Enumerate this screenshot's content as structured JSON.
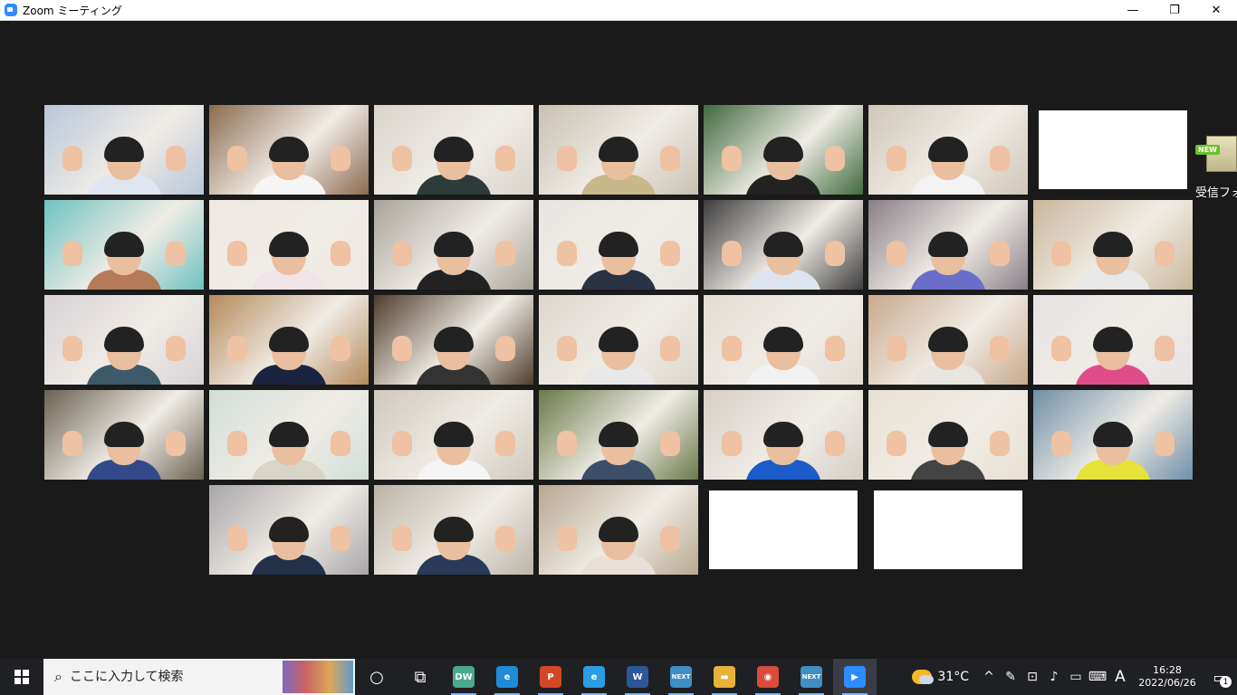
{
  "window": {
    "title": "Zoom ミーティング",
    "minimize": "—",
    "maximize": "❐",
    "close": "✕"
  },
  "gallery": {
    "active_speaker_color": "#e3e77a",
    "rows": [
      [
        "participant",
        "participant-active",
        "participant",
        "participant",
        "participant",
        "participant",
        "blank"
      ],
      [
        "participant",
        "participant",
        "participant",
        "participant",
        "participant",
        "participant",
        "participant"
      ],
      [
        "participant",
        "participant",
        "participant",
        "participant",
        "participant",
        "participant",
        "participant"
      ],
      [
        "participant",
        "participant",
        "participant",
        "participant",
        "participant",
        "participant",
        "participant"
      ],
      [
        "none",
        "participant",
        "participant",
        "participant",
        "blank",
        "blank",
        "none"
      ]
    ]
  },
  "desktop_icon": {
    "badge": "NEW",
    "label": "受信フォ"
  },
  "taskbar": {
    "search_placeholder": "ここに入力して検索",
    "apps": [
      {
        "name": "cortana",
        "glyph": "○",
        "color": "transparent"
      },
      {
        "name": "task-view",
        "glyph": "⧉",
        "color": "transparent"
      },
      {
        "name": "dw",
        "glyph": "DW",
        "color": "#4aa88c"
      },
      {
        "name": "edge",
        "glyph": "e",
        "color": "#1f8ad6"
      },
      {
        "name": "powerpoint",
        "glyph": "P",
        "color": "#d24726"
      },
      {
        "name": "ie",
        "glyph": "e",
        "color": "#2b9ee3"
      },
      {
        "name": "word",
        "glyph": "W",
        "color": "#2b579a"
      },
      {
        "name": "next1",
        "glyph": "NEXT",
        "color": "#3f8fc4"
      },
      {
        "name": "explorer",
        "glyph": "▬",
        "color": "#e8b13a"
      },
      {
        "name": "chrome",
        "glyph": "◉",
        "color": "#d94b3b"
      },
      {
        "name": "next2",
        "glyph": "NEXT",
        "color": "#3f8fc4"
      },
      {
        "name": "zoom",
        "glyph": "▶",
        "color": "#2d8cff"
      }
    ],
    "weather_temp": "31°C",
    "ime": "A",
    "time": "16:28",
    "date": "2022/06/26",
    "notification_count": "1"
  }
}
